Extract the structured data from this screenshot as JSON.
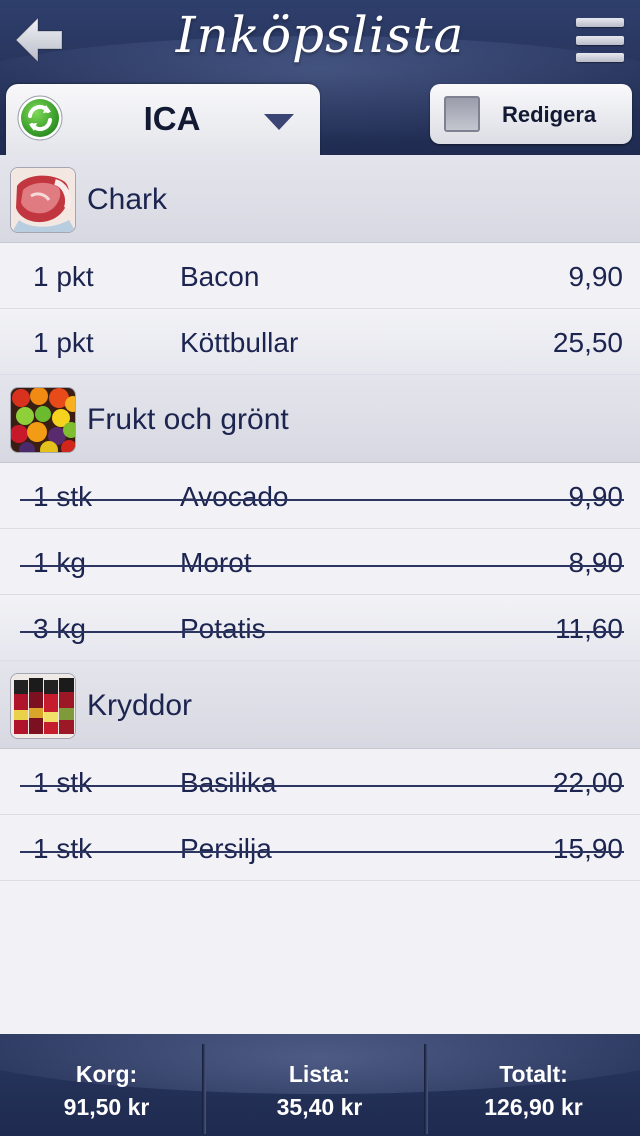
{
  "header": {
    "title": "Inköpslista",
    "back_icon": "arrow-left-icon",
    "menu_icon": "hamburger-menu-icon"
  },
  "store": {
    "name": "ICA",
    "refresh_icon": "refresh-icon",
    "dropdown_icon": "triangle-down-icon"
  },
  "edit": {
    "label": "Redigera",
    "checked": false
  },
  "categories": [
    {
      "name": "Chark",
      "items": [
        {
          "qty": "1 pkt",
          "name": "Bacon",
          "price": "9,90",
          "checked": false
        },
        {
          "qty": "1 pkt",
          "name": "Köttbullar",
          "price": "25,50",
          "checked": false
        }
      ]
    },
    {
      "name": "Frukt och grönt",
      "items": [
        {
          "qty": "1 stk",
          "name": "Avocado",
          "price": "9,90",
          "checked": true
        },
        {
          "qty": "1 kg",
          "name": "Morot",
          "price": "8,90",
          "checked": true
        },
        {
          "qty": "3 kg",
          "name": "Potatis",
          "price": "11,60",
          "checked": true
        }
      ]
    },
    {
      "name": "Kryddor",
      "items": [
        {
          "qty": "1 stk",
          "name": "Basilika",
          "price": "22,00",
          "checked": true
        },
        {
          "qty": "1 stk",
          "name": "Persilja",
          "price": "15,90",
          "checked": true
        }
      ]
    }
  ],
  "footer": {
    "basket": {
      "label": "Korg:",
      "value": "91,50 kr"
    },
    "list": {
      "label": "Lista:",
      "value": "35,40 kr"
    },
    "total": {
      "label": "Totalt:",
      "value": "126,90 kr"
    }
  },
  "colors": {
    "header_bg": "#25325a",
    "text": "#1c2450",
    "background": "#f2f2f6"
  }
}
